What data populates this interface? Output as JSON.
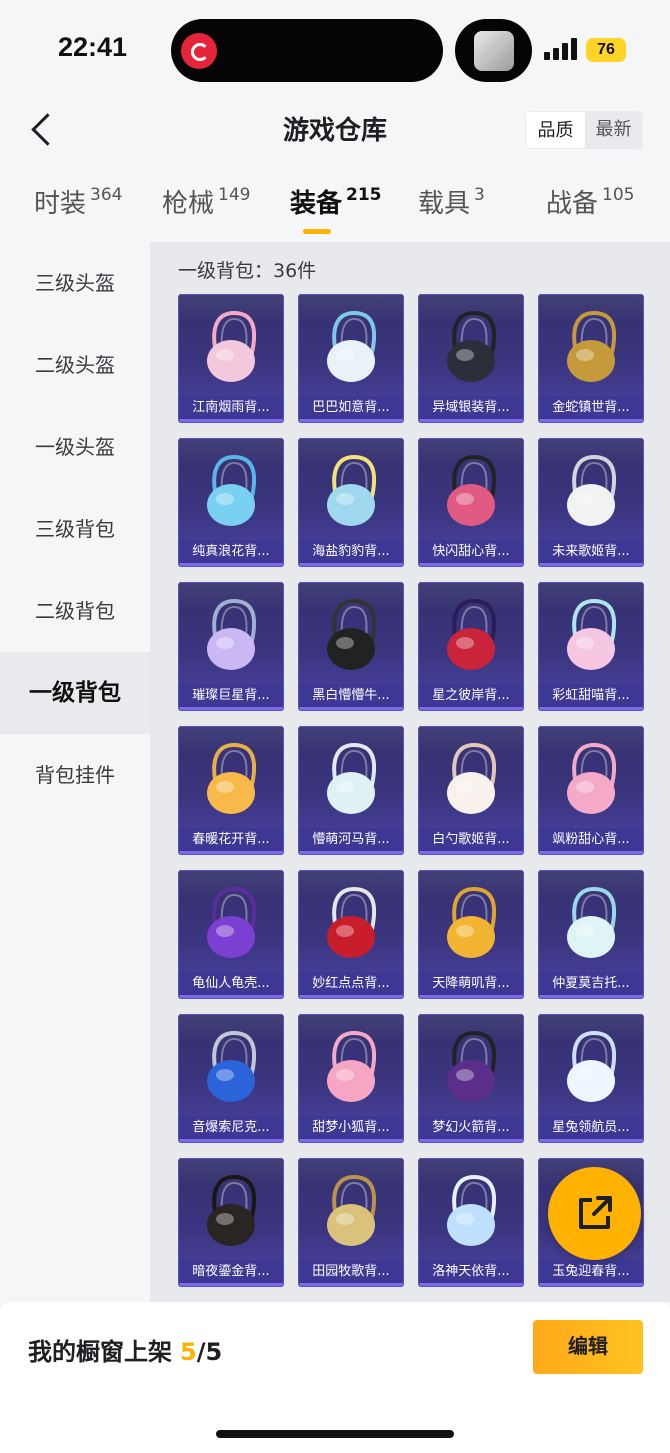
{
  "status_bar": {
    "time": "22:41",
    "battery": "76"
  },
  "header": {
    "title": "游戏仓库",
    "sort": [
      "品质",
      "最新"
    ]
  },
  "tabs": [
    {
      "label": "时装",
      "count": "364"
    },
    {
      "label": "枪械",
      "count": "149"
    },
    {
      "label": "装备",
      "count": "215"
    },
    {
      "label": "载具",
      "count": "3"
    },
    {
      "label": "战备",
      "count": "105"
    }
  ],
  "sidebar": [
    "三级头盔",
    "二级头盔",
    "一级头盔",
    "三级背包",
    "二级背包",
    "一级背包",
    "背包挂件"
  ],
  "content": {
    "count_label": "一级背包：36件"
  },
  "items": [
    "江南烟雨背...",
    "巴巴如意背...",
    "异域银装背...",
    "金蛇镇世背...",
    "纯真浪花背...",
    "海盐豹豹背...",
    "快闪甜心背...",
    "未来歌姬背...",
    "璀璨巨星背...",
    "黑白懵懵牛...",
    "星之彼岸背...",
    "彩虹甜喵背...",
    "春暖花开背...",
    "懵萌河马背...",
    "白勺歌姬背...",
    "飒粉甜心背...",
    "龟仙人龟壳...",
    "妙红点点背...",
    "天降萌叽背...",
    "仲夏莫吉托...",
    "音爆索尼克...",
    "甜梦小狐背...",
    "梦幻火箭背...",
    "星兔领航员...",
    "暗夜鎏金背...",
    "田园牧歌背...",
    "洛神天依背...",
    "玉兔迎春背..."
  ],
  "bottom": {
    "showcase_label": "我的橱窗上架",
    "showcase_count": "5",
    "showcase_total": "/5",
    "edit": "编辑"
  },
  "colors": {
    "accent": "#ffb300",
    "card_bg": "#3b3580",
    "card_bar": "#3d3894"
  }
}
